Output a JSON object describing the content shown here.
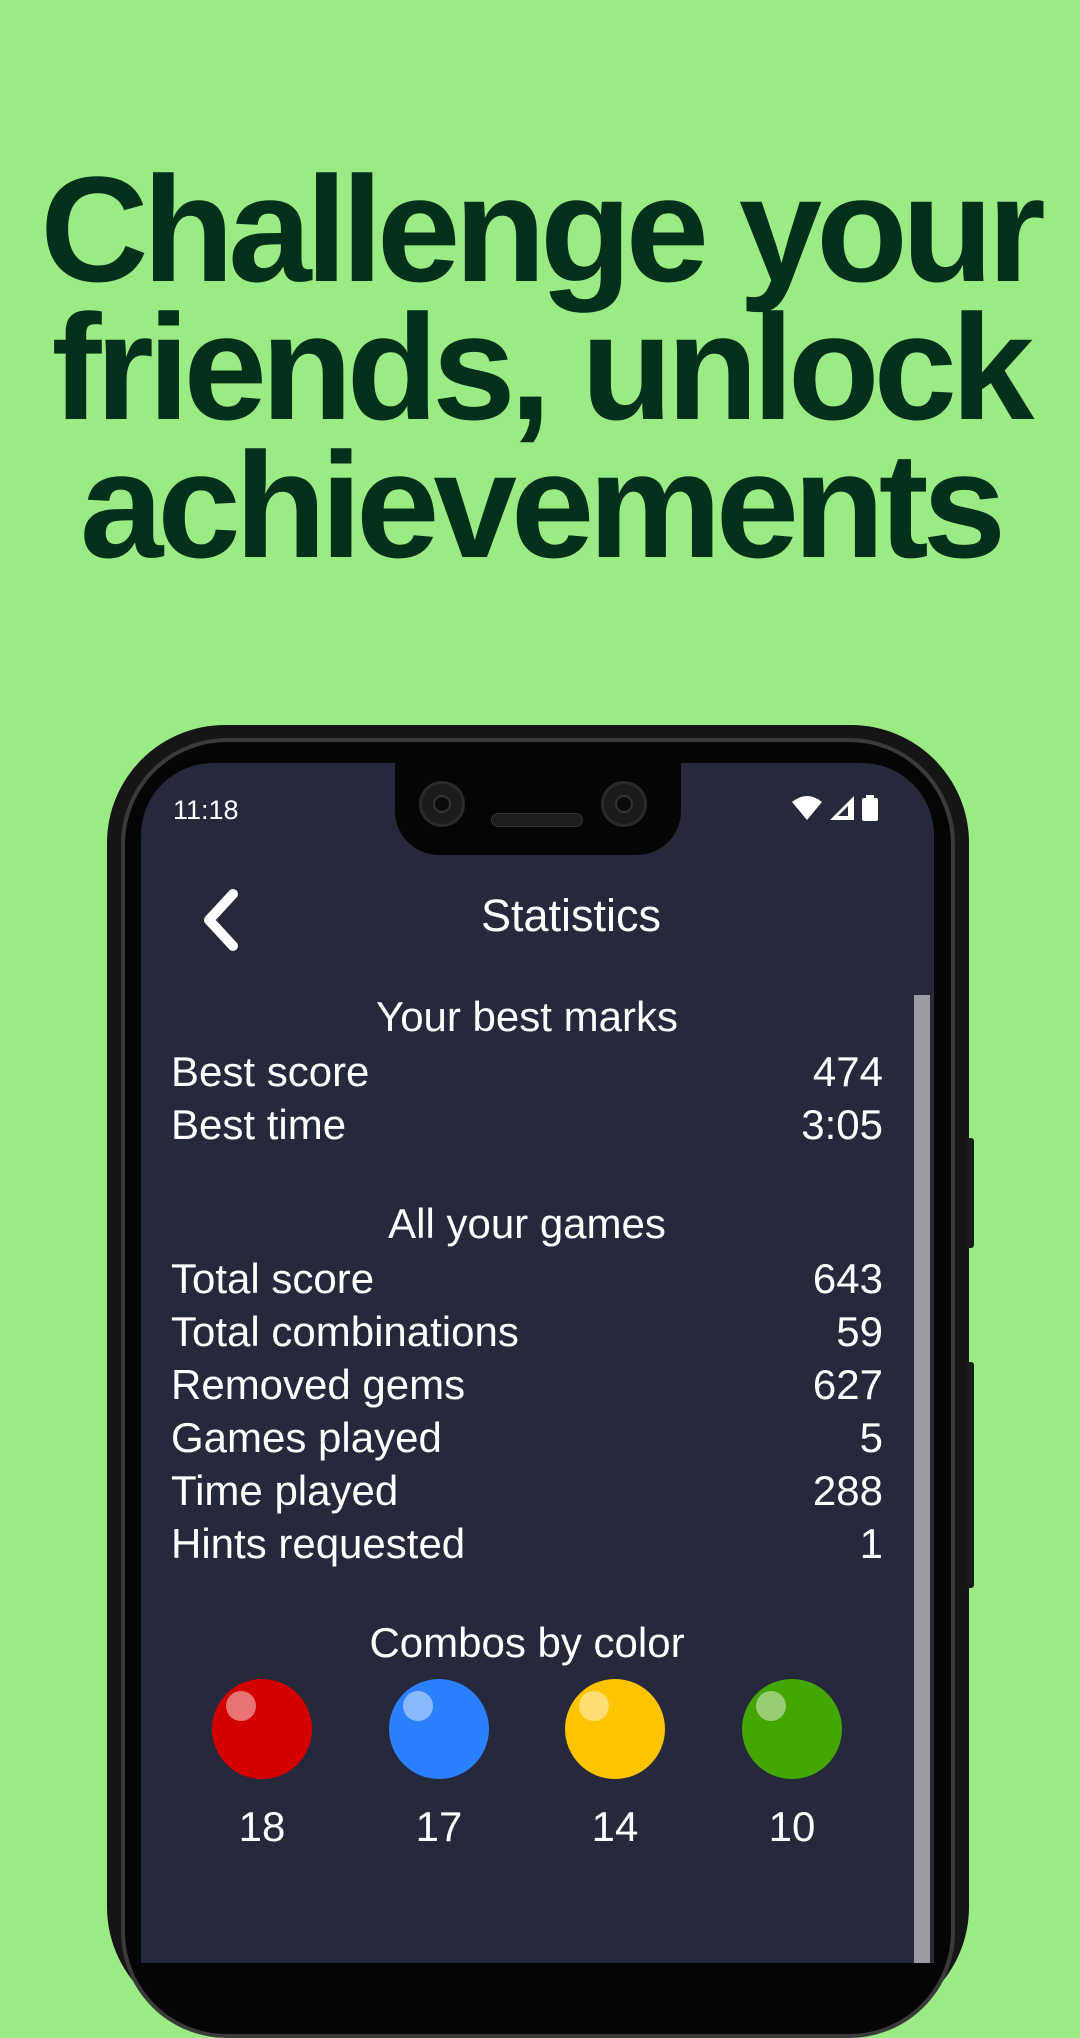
{
  "headline": {
    "line1": "Challenge your",
    "line2": "friends, unlock",
    "line3": "achievements"
  },
  "status_bar": {
    "time": "11:18",
    "icons": [
      "wifi-icon",
      "cell-signal-icon",
      "battery-icon"
    ]
  },
  "header": {
    "title": "Statistics",
    "back_icon": "chevron-left-icon"
  },
  "best_marks": {
    "heading": "Your best marks",
    "rows": [
      {
        "label": "Best score",
        "value": "474"
      },
      {
        "label": "Best time",
        "value": "3:05"
      }
    ]
  },
  "all_games": {
    "heading": "All your games",
    "rows": [
      {
        "label": "Total score",
        "value": "643"
      },
      {
        "label": "Total combinations",
        "value": "59"
      },
      {
        "label": "Removed gems",
        "value": "627"
      },
      {
        "label": "Games played",
        "value": "5"
      },
      {
        "label": "Time played",
        "value": "288"
      },
      {
        "label": "Hints requested",
        "value": "1"
      }
    ]
  },
  "combos": {
    "heading": "Combos by color",
    "gems": [
      {
        "color_name": "red",
        "color": "#d40000",
        "count": "18"
      },
      {
        "color_name": "blue",
        "color": "#2b80ff",
        "count": "17"
      },
      {
        "color_name": "yellow",
        "color": "#ffc400",
        "count": "14"
      },
      {
        "color_name": "green",
        "color": "#44a600",
        "count": "10"
      }
    ]
  },
  "colors": {
    "background": "#9beb85",
    "headline": "#03301b",
    "screen": "#25293b"
  }
}
